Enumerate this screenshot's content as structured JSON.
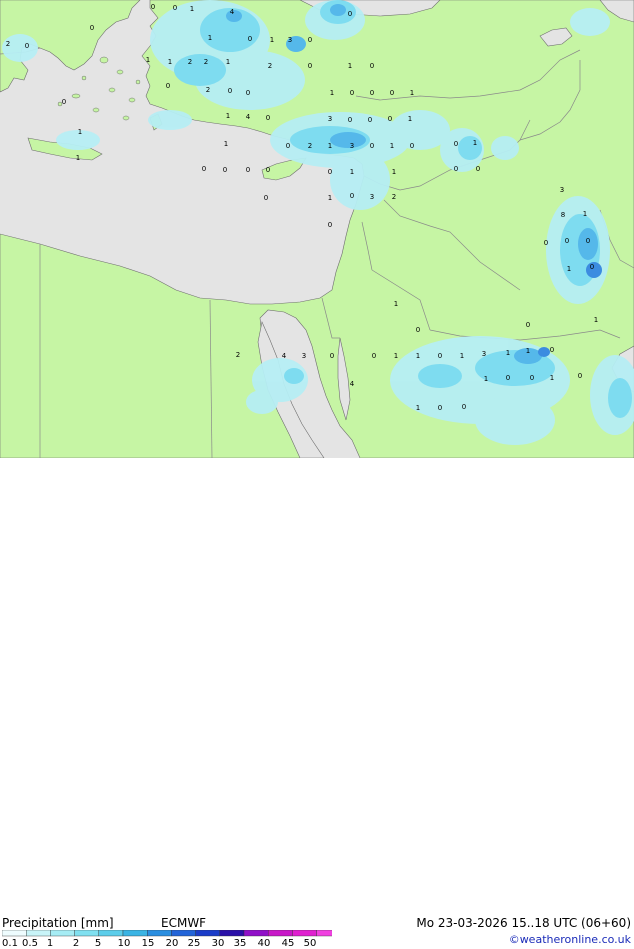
{
  "map": {
    "colors": {
      "sea": "#e4e4e4",
      "land": "#c6f5a4",
      "precip_light": "#b6eef4",
      "precip_mid": "#7edcf0",
      "precip_strong": "#55b8ea",
      "precip_heavy": "#3c8ce0",
      "border": "#8a8a8a",
      "coast": "#6e6e6e"
    },
    "point_values": [
      "0",
      "0",
      "1",
      "4",
      "0",
      "0",
      "2",
      "0",
      "1",
      "0",
      "1",
      "3",
      "0",
      "1",
      "1",
      "2",
      "2",
      "1",
      "2",
      "0",
      "1",
      "0",
      "0",
      "2",
      "0",
      "0",
      "1",
      "0",
      "0",
      "0",
      "1",
      "0",
      "3",
      "0",
      "0",
      "0",
      "1",
      "1",
      "4",
      "0",
      "0",
      "2",
      "1",
      "3",
      "0",
      "1",
      "0",
      "0",
      "1",
      "1",
      "1",
      "1",
      "0",
      "0",
      "0",
      "0",
      "0",
      "1",
      "1",
      "0",
      "0",
      "0",
      "1",
      "0",
      "3",
      "2",
      "0",
      "3",
      "8",
      "1",
      "0",
      "0",
      "0",
      "1",
      "0",
      "1",
      "0",
      "0",
      "1",
      "2",
      "4",
      "3",
      "0",
      "0",
      "1",
      "1",
      "0",
      "1",
      "3",
      "1",
      "1",
      "0",
      "4",
      "1",
      "0",
      "0",
      "1",
      "0",
      "1",
      "0",
      "0"
    ]
  },
  "footer": {
    "title": "Precipitation [mm]",
    "model": "ECMWF",
    "valid_time": "Mo 23-03-2026 15..18 UTC (06+60)",
    "copyright": "©weatheronline.co.uk",
    "scale_labels": [
      "0.1",
      "0.5",
      "1",
      "2",
      "5",
      "10",
      "15",
      "20",
      "25",
      "30",
      "35",
      "40",
      "45",
      "50"
    ],
    "scale_colors": [
      "#eefcfe",
      "#c8f4f8",
      "#a6ecf4",
      "#80e0f0",
      "#5ccdea",
      "#3ab4e4",
      "#2a8ee0",
      "#2264d8",
      "#1a3cc8",
      "#2a10a8",
      "#9010c8",
      "#c818c8",
      "#e020d0",
      "#f040e0"
    ]
  }
}
